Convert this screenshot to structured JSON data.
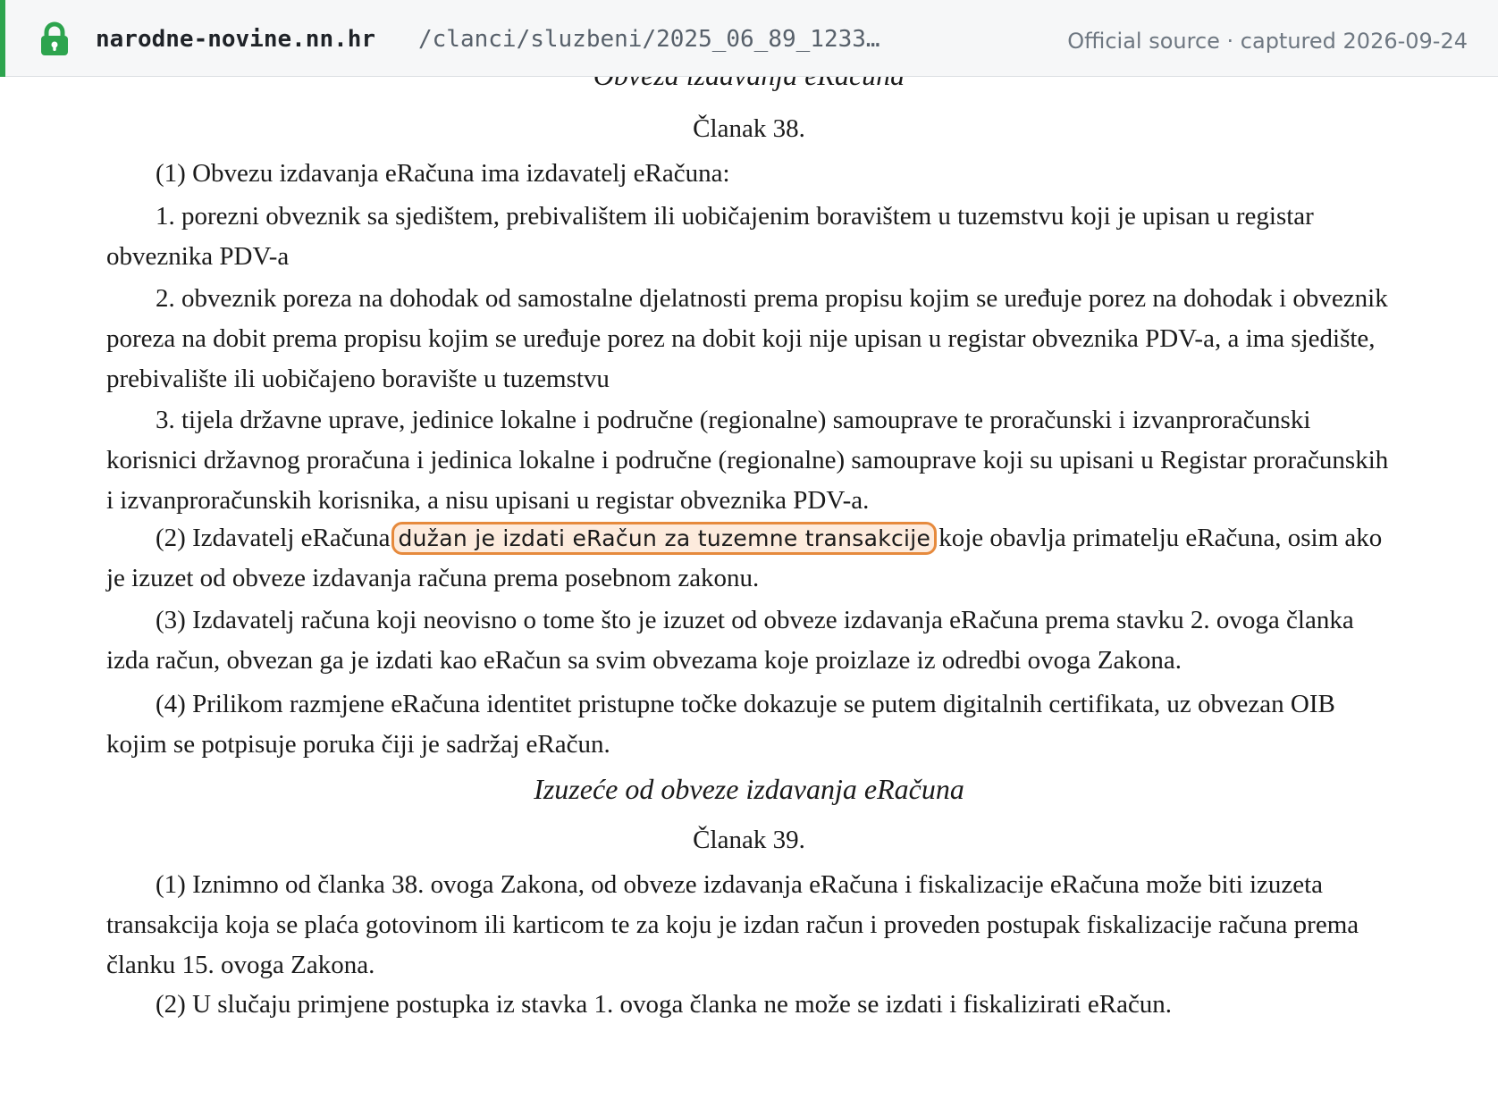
{
  "source_bar": {
    "host": "narodne-novine.nn.hr",
    "path": "/clanci/sluzbeni/2025_06_89_1233…",
    "note": "Official source · captured 2026-09-24",
    "accent_color": "#2da44e",
    "lock_color": "#2da44e",
    "lock_icon": "lock-icon"
  },
  "document": {
    "cut_heading": "Obveza izdavanja eRačuna",
    "article_38": {
      "label": "Članak 38.",
      "p1": "(1) Obvezu izdavanja eRačuna ima izdavatelj eRačuna:",
      "item1": "1. porezni obveznik sa sjedištem, prebivalištem ili uobičajenim boravištem u tuzemstvu koji je upisan u registar obveznika PDV-a",
      "item2": "2. obveznik poreza na dohodak od samostalne djelatnosti prema propisu kojim se uređuje porez na dohodak i obveznik poreza na dobit prema propisu kojim se uređuje porez na dobit koji nije upisan u registar obveznika PDV-a, a ima sjedište, prebivalište ili uobičajeno boravište u tuzemstvu",
      "item3": "3. tijela državne uprave, jedinice lokalne i područne (regionalne) samouprave te proračunski i izvanproračunski korisnici državnog proračuna i jedinica lokalne i područne (regionalne) samouprave koji su upisani u Registar proračunskih i izvanproračunskih korisnika, a nisu upisani u registar obveznika PDV-a.",
      "p2_before": "(2) Izdavatelj eRačuna",
      "p2_highlight": "dužan je izdati eRačun za tuzemne transakcije",
      "p2_after": "koje obavlja primatelju eRačuna, osim ako je izuzet od obveze izdavanja računa prema posebnom zakonu.",
      "p3": "(3) Izdavatelj računa koji neovisno o tome što je izuzet od obveze izdavanja eRačuna prema stavku 2. ovoga članka izda račun, obvezan ga je izdati kao eRačun sa svim obvezama koje proizlaze iz odredbi ovoga Zakona.",
      "p4": "(4) Prilikom razmjene eRačuna identitet pristupne točke dokazuje se putem digitalnih certifikata, uz obvezan OIB kojim se potpisuje poruka čiji je sadržaj eRačun."
    },
    "section_39_title": "Izuzeće od obveze izdavanja eRačuna",
    "article_39": {
      "label": "Članak 39.",
      "p1": "(1) Iznimno od članka 38. ovoga Zakona, od obveze izdavanja eRačuna i fiskalizacije eRačuna može biti izuzeta transakcija koja se plaća gotovinom ili karticom te za koju je izdan račun i proveden postupak fiskalizacije računa prema članku 15. ovoga Zakona.",
      "p2": "(2) U slučaju primjene postupka iz stavka 1. ovoga članka ne može se izdati i fiskalizirati eRačun."
    },
    "highlight_border_color": "#e68a3d",
    "highlight_fill_color": "#fdebdd"
  }
}
